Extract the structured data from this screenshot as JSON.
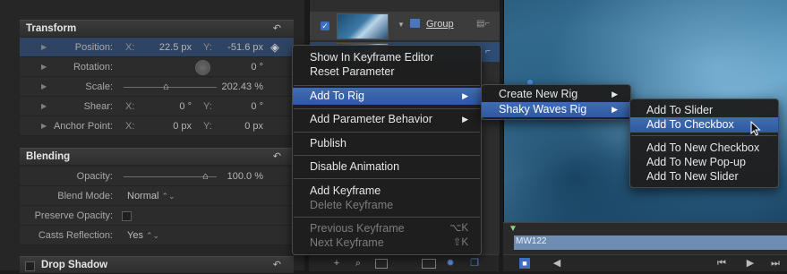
{
  "inspector": {
    "transform": {
      "title": "Transform",
      "reset_glyph": "↶",
      "position": {
        "label": "Position:",
        "x_axis": "X:",
        "x": "22.5 px",
        "y_axis": "Y:",
        "y": "-51.6 px"
      },
      "rotation": {
        "label": "Rotation:",
        "value": "0 °"
      },
      "scale": {
        "label": "Scale:",
        "value": "202.43 %"
      },
      "shear": {
        "label": "Shear:",
        "x_axis": "X:",
        "x": "0 °",
        "y_axis": "Y:",
        "y": "0 °"
      },
      "anchor": {
        "label": "Anchor Point:",
        "x_axis": "X:",
        "x": "0 px",
        "y_axis": "Y:",
        "y": "0 px"
      }
    },
    "blending": {
      "title": "Blending",
      "reset_glyph": "↶",
      "opacity": {
        "label": "Opacity:",
        "value": "100.0 %"
      },
      "blend_mode": {
        "label": "Blend Mode:",
        "value": "Normal",
        "arrows": "⌃⌄"
      },
      "preserve_opacity": {
        "label": "Preserve Opacity:"
      },
      "casts_reflection": {
        "label": "Casts Reflection:",
        "value": "Yes",
        "arrows": "⌃⌄"
      }
    },
    "drop_shadow": {
      "title": "Drop Shadow",
      "reset_glyph": "↶"
    }
  },
  "layers": {
    "group_row": {
      "name": "Group",
      "check": "✓"
    },
    "toolbar": {
      "add": "+",
      "search": "⌕"
    }
  },
  "timeline": {
    "clip_label": "MW122"
  },
  "context_menu": {
    "items": [
      {
        "label": "Show In Keyframe Editor"
      },
      {
        "label": "Reset Parameter"
      },
      {
        "label": "Add To Rig",
        "submenu": "▶"
      },
      {
        "label": "Add Parameter Behavior",
        "submenu": "▶"
      },
      {
        "label": "Publish"
      },
      {
        "label": "Disable Animation"
      },
      {
        "label": "Add Keyframe"
      },
      {
        "label": "Delete Keyframe"
      },
      {
        "label": "Previous Keyframe",
        "shortcut": "⌥K"
      },
      {
        "label": "Next Keyframe",
        "shortcut": "⇧K"
      }
    ]
  },
  "rig_menu": {
    "items": [
      {
        "label": "Create New Rig",
        "submenu": "▶"
      },
      {
        "label": "Shaky Waves Rig",
        "submenu": "▶"
      }
    ]
  },
  "widget_menu": {
    "items": [
      {
        "label": "Add To Slider"
      },
      {
        "label": "Add To Checkbox"
      },
      {
        "label": "Add To New Checkbox"
      },
      {
        "label": "Add To New Pop-up"
      },
      {
        "label": "Add To New Slider"
      }
    ]
  },
  "colors": {
    "accent_blue": "#3f6db4",
    "selected_row": "#2f4462",
    "timeline_clip": "#6f8db3"
  }
}
